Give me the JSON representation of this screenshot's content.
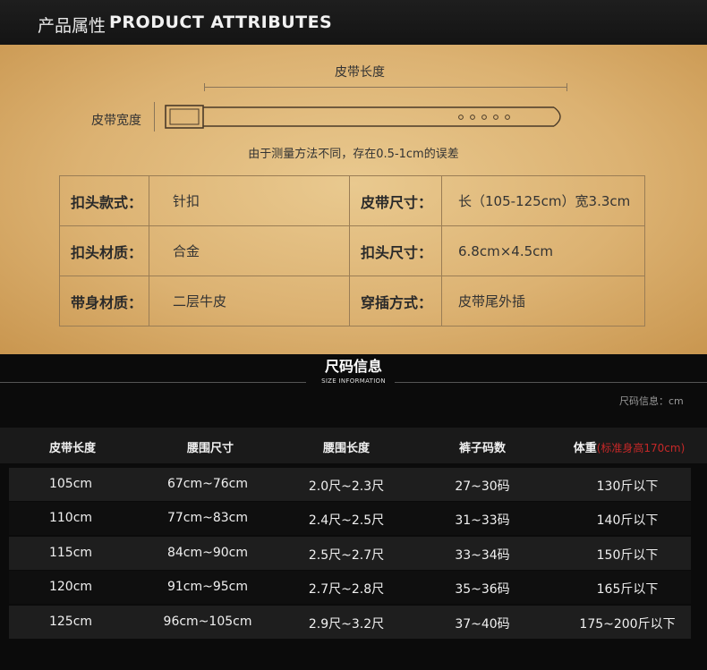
{
  "header": {
    "title_cn": "产品属性",
    "title_en": "PRODUCT  ATTRIBUTES"
  },
  "diagram": {
    "length_label": "皮带长度",
    "width_label": "皮带宽度",
    "note": "由于测量方法不同，存在0.5-1cm的误差"
  },
  "attributes": [
    {
      "k1": "扣头款式：",
      "v1": "针扣",
      "k2": "皮带尺寸：",
      "v2": "长（105-125cm）宽3.3cm"
    },
    {
      "k1": "扣头材质：",
      "v1": "合金",
      "k2": "扣头尺寸：",
      "v2": "6.8cm×4.5cm"
    },
    {
      "k1": "带身材质：",
      "v1": "二层牛皮",
      "k2": "穿插方式：",
      "v2": "皮带尾外插"
    }
  ],
  "size_info": {
    "title": "尺码信息",
    "subtitle": "SIZE INFORMATION",
    "unit": "尺码信息：cm",
    "headers": [
      "皮带长度",
      "腰围尺寸",
      "腰围长度",
      "裤子码数",
      "体重"
    ],
    "weight_note": "(标准身高170cm)",
    "rows": [
      [
        "105cm",
        "67cm~76cm",
        "2.0尺~2.3尺",
        "27~30码",
        "130斤以下"
      ],
      [
        "110cm",
        "77cm~83cm",
        "2.4尺~2.5尺",
        "31~33码",
        "140斤以下"
      ],
      [
        "115cm",
        "84cm~90cm",
        "2.5尺~2.7尺",
        "33~34码",
        "150斤以下"
      ],
      [
        "120cm",
        "91cm~95cm",
        "2.7尺~2.8尺",
        "35~36码",
        "165斤以下"
      ],
      [
        "125cm",
        "96cm~105cm",
        "2.9尺~3.2尺",
        "37~40码",
        "175~200斤以下"
      ]
    ]
  },
  "colors": {
    "panel": "#dcb272",
    "accent_red": "#c62828"
  }
}
